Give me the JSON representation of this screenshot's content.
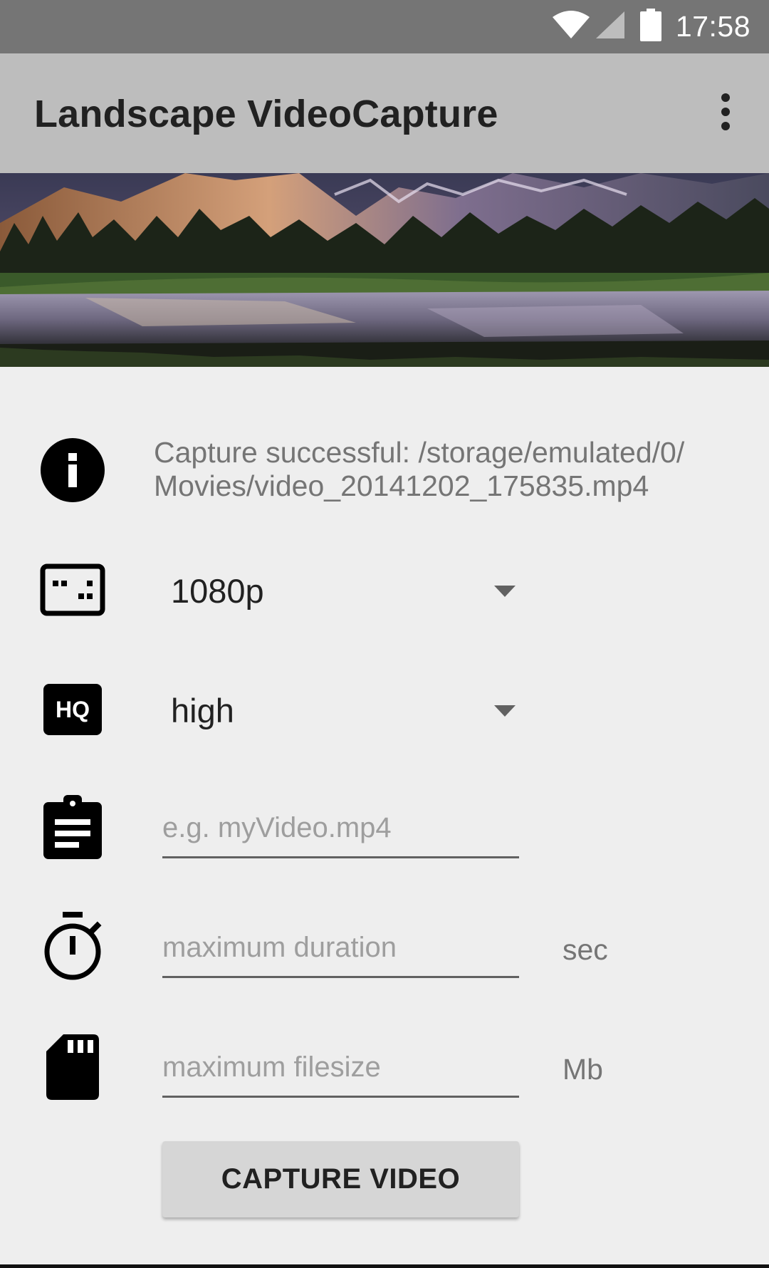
{
  "status_bar": {
    "time": "17:58",
    "icons": [
      "wifi-icon",
      "cell-signal-icon",
      "battery-icon"
    ]
  },
  "app_bar": {
    "title": "Landscape VideoCapture",
    "overflow_icon": "more-vert-icon"
  },
  "banner": {
    "description_icon": "landscape-image"
  },
  "info": {
    "icon": "info-icon",
    "message": "Capture successful: /storage/emulated/0/\nMovies/video_20141202_175835.mp4"
  },
  "resolution": {
    "icon": "aspect-ratio-icon",
    "selected": "1080p"
  },
  "quality": {
    "icon": "hq-icon",
    "selected": "high"
  },
  "filename": {
    "icon": "clipboard-icon",
    "placeholder": "e.g. myVideo.mp4",
    "value": ""
  },
  "duration": {
    "icon": "timer-icon",
    "placeholder": "maximum duration",
    "value": "",
    "unit": "sec"
  },
  "filesize": {
    "icon": "sd-card-icon",
    "placeholder": "maximum filesize",
    "value": "",
    "unit": "Mb"
  },
  "capture_button": {
    "label": "CAPTURE VIDEO"
  },
  "colors": {
    "status_bar": "#757575",
    "app_bar": "#bdbdbd",
    "background": "#eeeeee",
    "button": "#d6d6d6"
  }
}
